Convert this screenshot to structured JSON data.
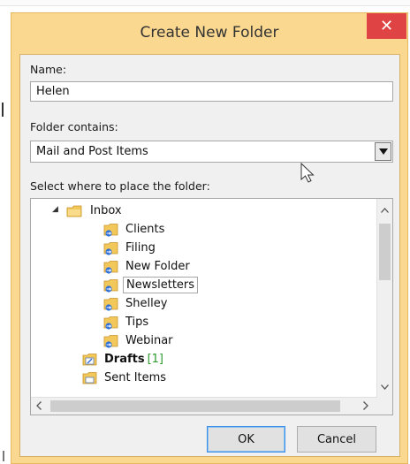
{
  "dialog": {
    "title": "Create New Folder",
    "close_glyph": "✕",
    "name_label": "Name:",
    "name_value": "Helen",
    "contains_label": "Folder contains:",
    "contains_value": "Mail and Post Items",
    "location_label": "Select where to place the folder:",
    "ok_label": "OK",
    "cancel_label": "Cancel"
  },
  "tree": {
    "inbox": {
      "label": "Inbox",
      "icon": "inbox-icon",
      "expander": "◢"
    },
    "subfolders": [
      {
        "label": "Clients",
        "icon": "folder-sync-icon"
      },
      {
        "label": "Filing",
        "icon": "folder-sync-icon"
      },
      {
        "label": "New Folder",
        "icon": "folder-sync-icon"
      },
      {
        "label": "Newsletters",
        "icon": "folder-sync-icon",
        "selected": true
      },
      {
        "label": "Shelley",
        "icon": "folder-sync-icon"
      },
      {
        "label": "Tips",
        "icon": "folder-sync-icon"
      },
      {
        "label": "Webinar",
        "icon": "folder-sync-icon"
      }
    ],
    "drafts": {
      "label": "Drafts",
      "count": "[1]",
      "icon": "drafts-icon"
    },
    "sent": {
      "label": "Sent Items",
      "icon": "sent-items-icon"
    }
  },
  "colors": {
    "frame": "#fbd890",
    "close": "#e04343",
    "count_green": "#2e9a2e",
    "folder_yellow": "#f3c85a",
    "sync_blue": "#2f6fd6"
  }
}
